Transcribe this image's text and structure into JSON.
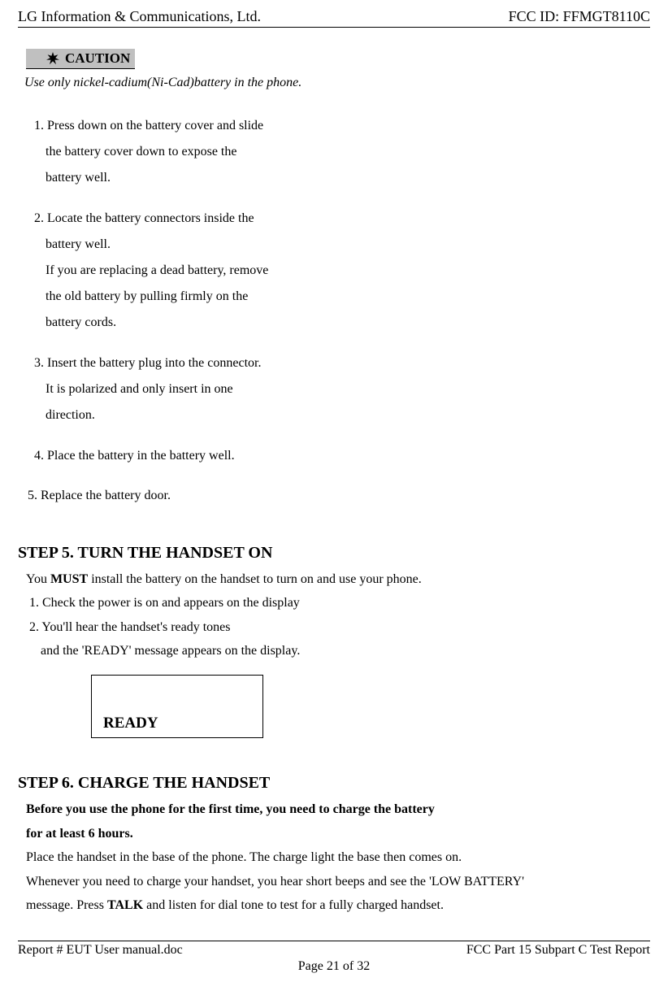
{
  "header": {
    "left": "LG Information & Communications, Ltd.",
    "right": "FCC ID: FFMGT8110C"
  },
  "caution": {
    "label": "CAUTION",
    "text": "Use only nickel-cadium(Ni-Cad)battery in the phone."
  },
  "steps_main": {
    "s1_first": "1.  Press down on the battery cover and slide",
    "s1_l2": "the battery cover down to expose the",
    "s1_l3": "battery well.",
    "s2_first": "2.  Locate the battery connectors inside the",
    "s2_l2": "battery well.",
    "s2_l3": "If you are replacing a dead battery, remove",
    "s2_l4": "the old battery by pulling firmly on the",
    "s2_l5": "battery cords.",
    "s3_first": "3. Insert the battery plug into the connector.",
    "s3_l2": "It is polarized and only insert in one",
    "s3_l3": "direction.",
    "s4": "4.  Place the battery in the battery well.",
    "s5": "5.  Replace the battery door."
  },
  "step5": {
    "heading": "STEP  5.  TURN THE HANDSET ON",
    "intro_pre": "You ",
    "intro_bold": "MUST",
    "intro_post": " install the battery on the handset to turn on and use your phone.",
    "l1": "1.  Check the power is on and appears on the display",
    "l2": "2.  You'll hear the handset's ready tones",
    "l3": "and the 'READY' message appears on the display.",
    "display": "READY"
  },
  "step6": {
    "heading": "STEP  6.  CHARGE THE HANDSET",
    "b1": "Before you use the phone for the first time, you need to charge the battery",
    "b2": "for at least 6 hours.",
    "l1": "Place the handset in the base of the phone.  The charge light the base then comes on.",
    "l2": "Whenever you need to charge your handset, you hear short beeps and see the 'LOW BATTERY'",
    "l3_pre": "message. Press ",
    "l3_bold": "TALK",
    "l3_post": " and listen for dial tone to test for a fully charged handset."
  },
  "footer": {
    "left": "Report # EUT User manual.doc",
    "right": "FCC Part 15 Subpart C Test Report",
    "center": "Page 21 of 32"
  }
}
